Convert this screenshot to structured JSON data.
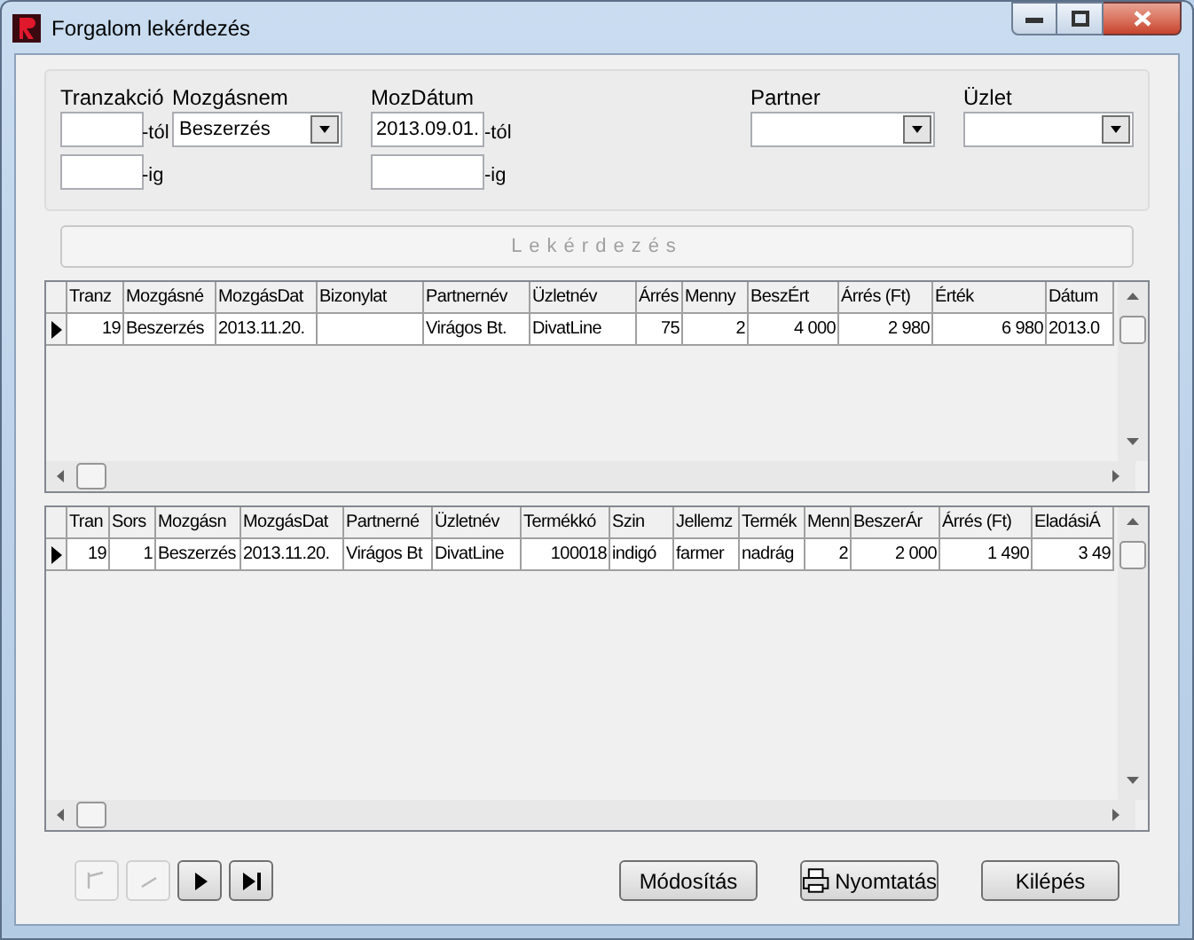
{
  "window": {
    "title": "Forgalom lekérdezés"
  },
  "filters": {
    "tranzakcio": {
      "label": "Tranzakció",
      "from_suffix": "-tól",
      "to_suffix": "-ig"
    },
    "mozgasnem": {
      "label": "Mozgásnem",
      "value": "Beszerzés"
    },
    "mozdatum": {
      "label": "MozDátum",
      "from_value": "2013.09.01.",
      "from_suffix": "-tól",
      "to_suffix": "-ig"
    },
    "partner": {
      "label": "Partner"
    },
    "uzlet": {
      "label": "Üzlet"
    }
  },
  "query_button": {
    "label": "Lekérdezés",
    "disabled": true
  },
  "grids": [
    {
      "columns": [
        {
          "label": "Tranz",
          "kind": "numeric"
        },
        {
          "label": "Mozgásné",
          "kind": "text"
        },
        {
          "label": "MozgásDat",
          "kind": "text"
        },
        {
          "label": "Bizonylat",
          "kind": "text"
        },
        {
          "label": "Partnernév",
          "kind": "text"
        },
        {
          "label": "Üzletnév",
          "kind": "text"
        },
        {
          "label": "Árrés",
          "kind": "numeric"
        },
        {
          "label": "Menny",
          "kind": "numeric"
        },
        {
          "label": "BeszÉrt",
          "kind": "numeric"
        },
        {
          "label": "Árrés (Ft)",
          "kind": "numeric"
        },
        {
          "label": "Érték",
          "kind": "numeric"
        },
        {
          "label": "Dátum",
          "kind": "text"
        }
      ],
      "rows": [
        {
          "selected": true,
          "cells": [
            "19",
            "Beszerzés",
            "2013.11.20.",
            "",
            "Virágos Bt.",
            "DivatLine",
            "75",
            "2",
            "4 000",
            "2 980",
            "6 980",
            "2013.0"
          ]
        }
      ]
    },
    {
      "columns": [
        {
          "label": "Tran",
          "kind": "numeric"
        },
        {
          "label": "Sors",
          "kind": "numeric"
        },
        {
          "label": "Mozgásn",
          "kind": "text"
        },
        {
          "label": "MozgásDat",
          "kind": "text"
        },
        {
          "label": "Partnerné",
          "kind": "text"
        },
        {
          "label": "Üzletnév",
          "kind": "text"
        },
        {
          "label": "Termékkó",
          "kind": "numeric"
        },
        {
          "label": "Szin",
          "kind": "text"
        },
        {
          "label": "Jellemz",
          "kind": "text"
        },
        {
          "label": "Termék",
          "kind": "text"
        },
        {
          "label": "Menn",
          "kind": "numeric"
        },
        {
          "label": "BeszerÁr",
          "kind": "numeric"
        },
        {
          "label": "Árrés (Ft)",
          "kind": "numeric"
        },
        {
          "label": "EladásiÁ",
          "kind": "numeric"
        }
      ],
      "rows": [
        {
          "selected": true,
          "cells": [
            "19",
            "1",
            "Beszerzés",
            "2013.11.20.",
            "Virágos Bt",
            "DivatLine",
            "100018",
            "indigó",
            "farmer",
            "nadrág",
            "2",
            "2 000",
            "1 490",
            "3 49"
          ]
        }
      ]
    }
  ],
  "navigator": [
    {
      "kind": "first",
      "disabled": true
    },
    {
      "kind": "prior",
      "disabled": true
    },
    {
      "kind": "next",
      "disabled": false
    },
    {
      "kind": "last",
      "disabled": false
    }
  ],
  "buttons": [
    {
      "label": "Módosítás",
      "kind": "plain"
    },
    {
      "label": "Nyomtatás",
      "kind": "print"
    },
    {
      "label": "Kilépés",
      "kind": "plain"
    }
  ]
}
